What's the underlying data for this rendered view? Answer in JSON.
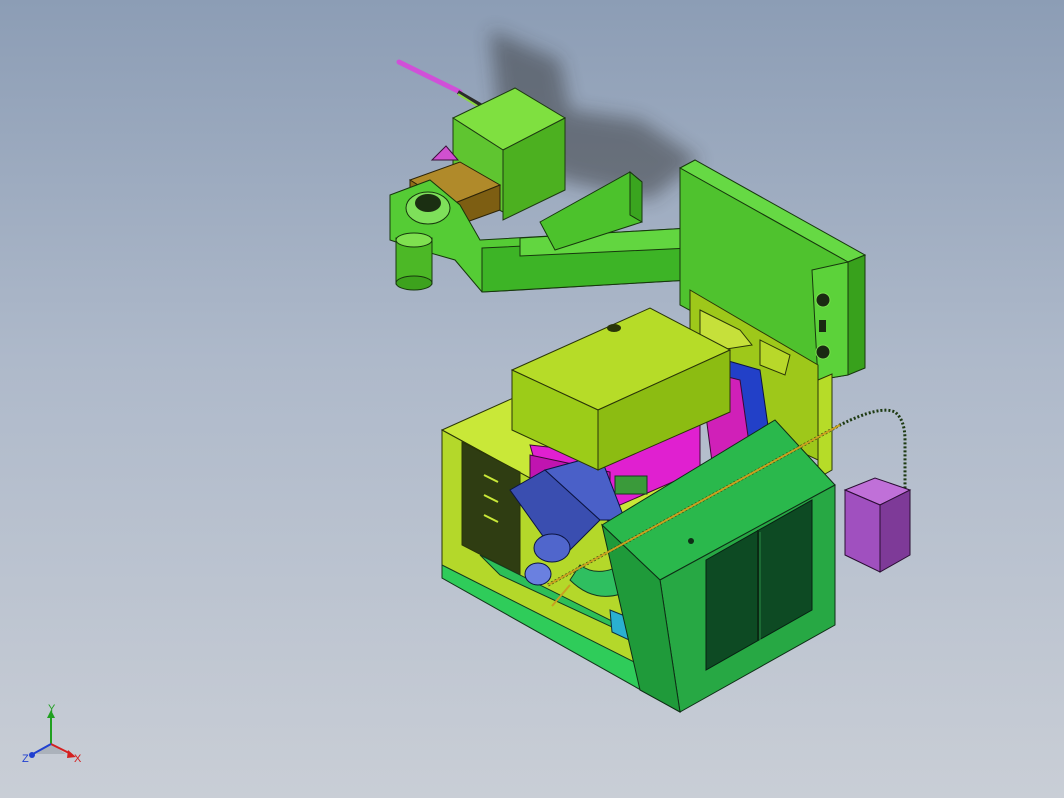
{
  "viewport": {
    "background_top": "#8c9db5",
    "background_bottom": "#c9ced6"
  },
  "triad": {
    "x_label": "X",
    "y_label": "Y",
    "z_label": "Z",
    "x_color": "#d42020",
    "y_color": "#20a020",
    "z_color": "#2040d0"
  },
  "model": {
    "parts": [
      "robot-tool-rod",
      "robot-motor-block",
      "robot-wrist",
      "robot-arm",
      "robot-upper-arm",
      "robot-base-column",
      "control-cabinet",
      "machine-spindle-head",
      "machine-enclosure",
      "front-door-panel",
      "coolant-tank",
      "coolant-hose"
    ]
  }
}
